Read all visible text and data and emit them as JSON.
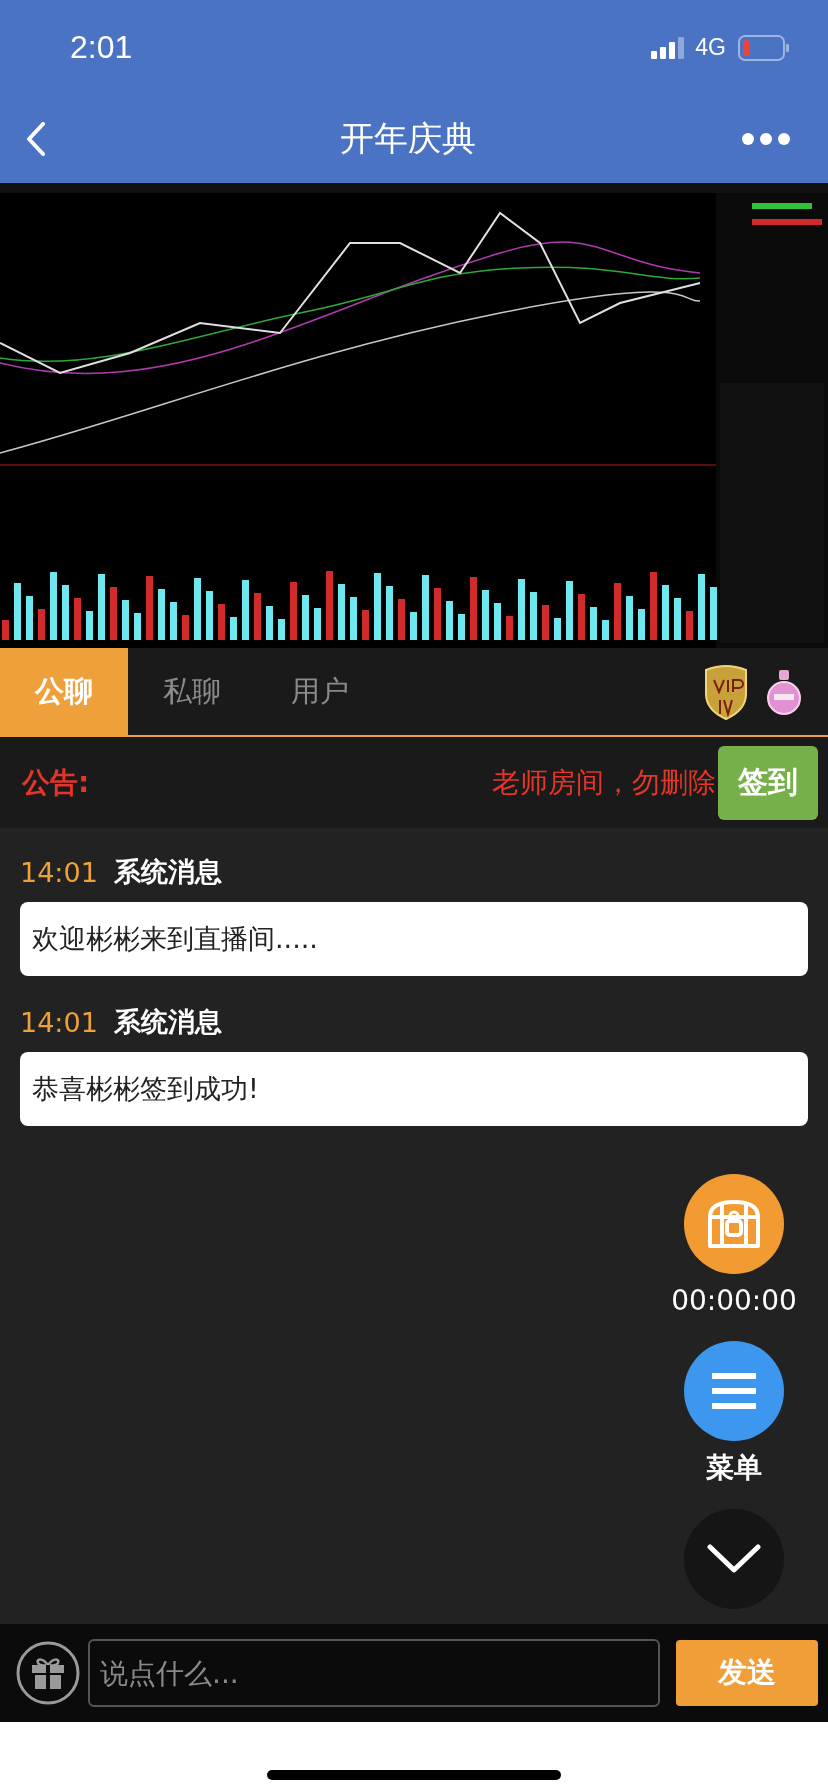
{
  "status_bar": {
    "time": "2:01",
    "network": "4G"
  },
  "nav": {
    "title": "开年庆典"
  },
  "tabs": [
    {
      "label": "公聊",
      "selected": true
    },
    {
      "label": "私聊",
      "selected": false
    },
    {
      "label": "用户",
      "selected": false
    }
  ],
  "notice": {
    "label": "公告:",
    "text": "老师房间，勿删除",
    "button": "签到"
  },
  "messages": [
    {
      "time": "14:01",
      "sender": "系统消息",
      "text": "欢迎彬彬来到直播间....."
    },
    {
      "time": "14:01",
      "sender": "系统消息",
      "text": "恭喜彬彬签到成功!"
    }
  ],
  "floating": {
    "timer": "00:00:00",
    "menu_label": "菜单"
  },
  "composer": {
    "placeholder": "说点什么...",
    "send": "发送"
  }
}
